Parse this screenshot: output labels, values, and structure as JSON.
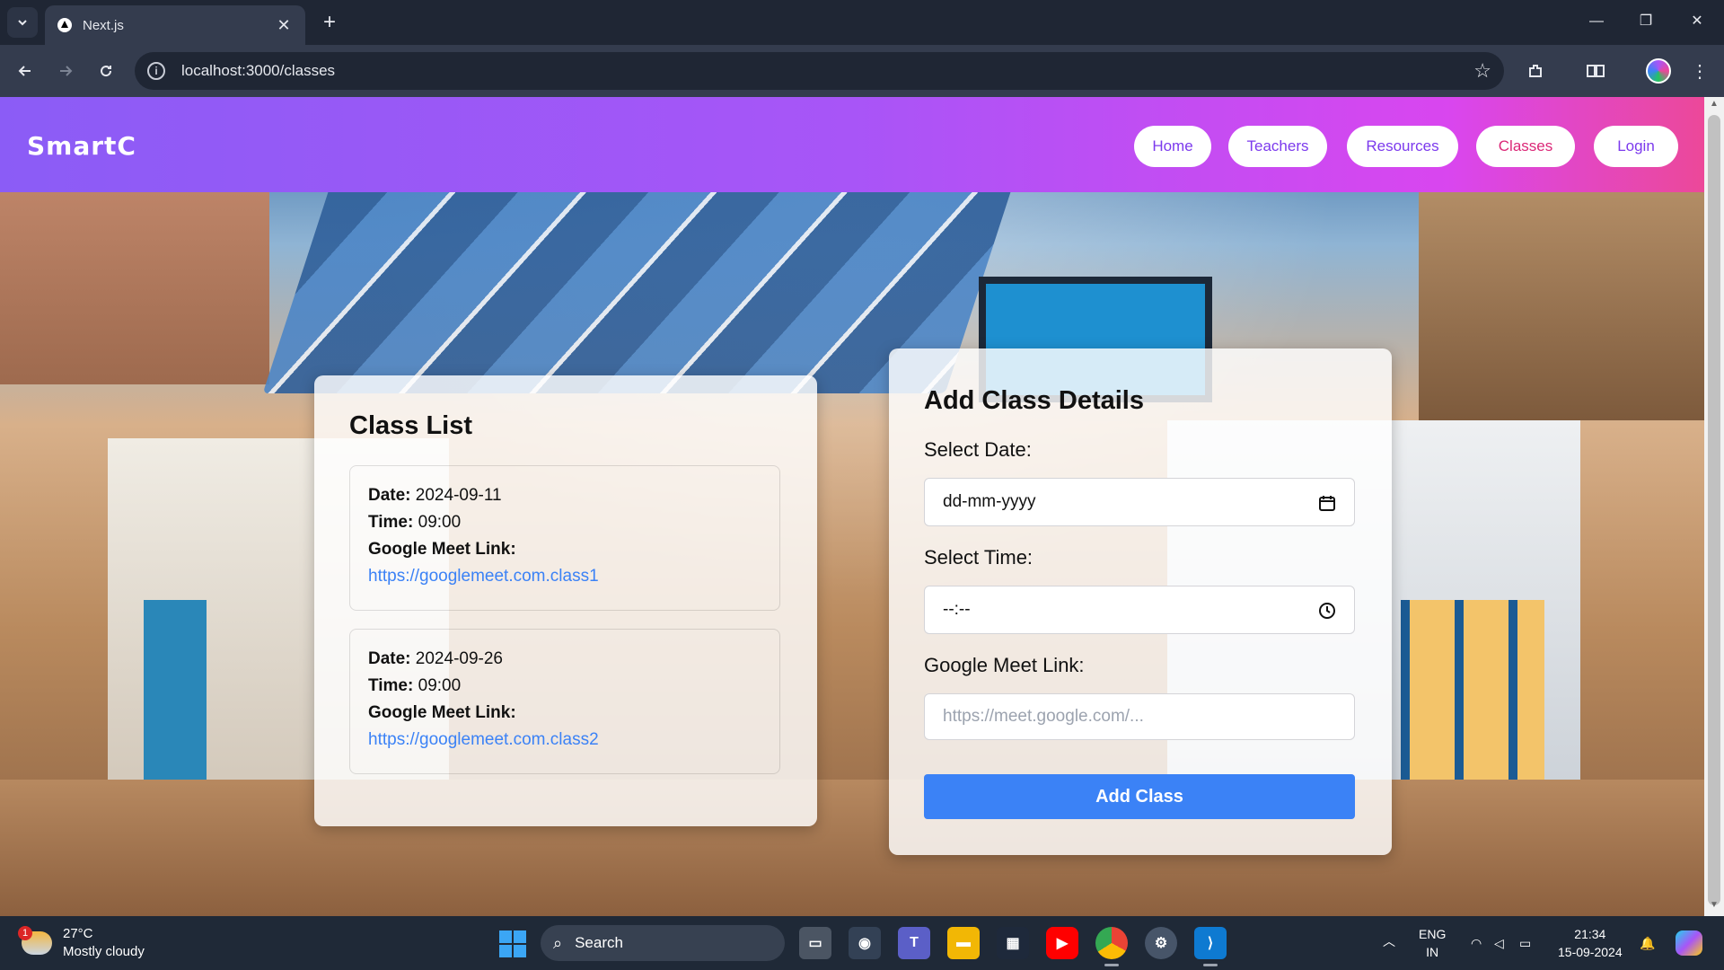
{
  "browser": {
    "tab_title": "Next.js",
    "url": "localhost:3000/classes"
  },
  "site": {
    "logo": "SmartC",
    "nav": [
      "Home",
      "Teachers",
      "Resources",
      "Classes",
      "Login"
    ],
    "active_nav": "Classes"
  },
  "class_list": {
    "title": "Class List",
    "date_label": "Date:",
    "time_label": "Time:",
    "link_label": "Google Meet Link:",
    "items": [
      {
        "date": "2024-09-11",
        "time": "09:00",
        "link": "https://googlemeet.com.class1"
      },
      {
        "date": "2024-09-26",
        "time": "09:00",
        "link": "https://googlemeet.com.class2"
      }
    ]
  },
  "form": {
    "title": "Add Class Details",
    "date_label": "Select Date:",
    "date_value": "dd-mm-yyyy",
    "time_label": "Select Time:",
    "time_value": "--:--",
    "link_label": "Google Meet Link:",
    "link_placeholder": "https://meet.google.com/...",
    "submit": "Add Class"
  },
  "taskbar": {
    "weather_temp": "27°C",
    "weather_desc": "Mostly cloudy",
    "weather_badge": "1",
    "search": "Search",
    "lang_1": "ENG",
    "lang_2": "IN",
    "time": "21:34",
    "date": "15-09-2024"
  },
  "colors": {
    "header_gradient_start": "#8b5cf6",
    "header_gradient_end": "#ec4899",
    "accent_blue": "#3b82f6",
    "nav_text": "#7c3aed"
  }
}
